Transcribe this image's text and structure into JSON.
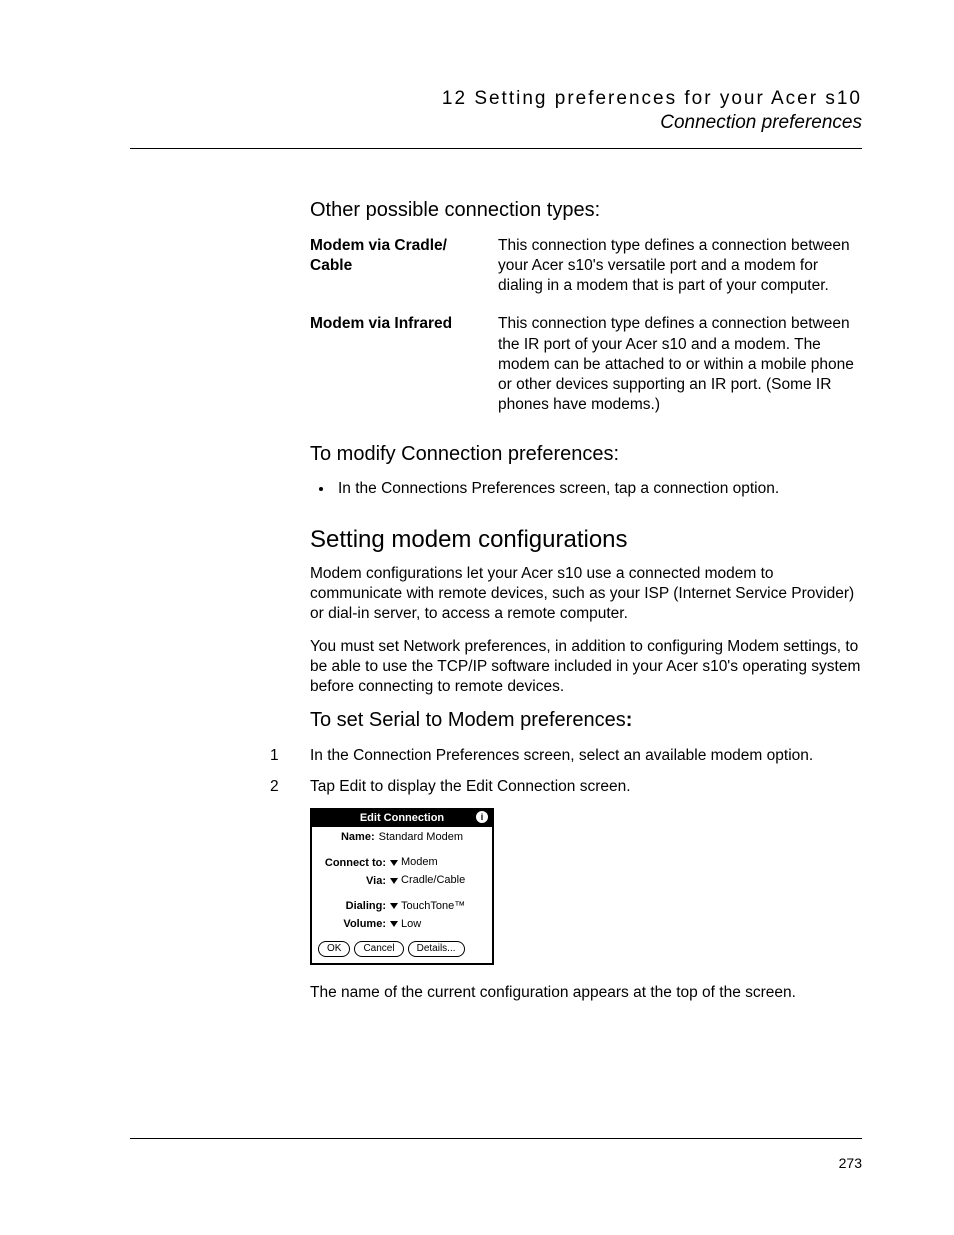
{
  "header": {
    "running_title": "12 Setting preferences for your Acer s10",
    "subtitle": "Connection preferences"
  },
  "sections": {
    "other_types_heading": "Other possible connection types:",
    "defs": [
      {
        "term": "Modem via Cradle/ Cable",
        "desc": "This connection type defines a connection between your Acer s10's versatile port and a modem for dialing in a modem that is part of your computer."
      },
      {
        "term": "Modem via Infrared",
        "desc": "This connection type defines a connection between the IR port of your Acer s10 and a modem. The modem can be attached to or within a mobile phone or other devices supporting an IR port. (Some IR phones have modems.)"
      }
    ],
    "modify_heading": "To modify Connection preferences:",
    "modify_bullet": "In the Connections Preferences screen, tap a connection option.",
    "h2": "Setting modem configurations",
    "para1": "Modem configurations let your Acer s10 use a connected modem to communicate with remote devices, such as your ISP (Internet Service Provider) or dial-in server, to access a remote computer.",
    "para2": "You must set Network preferences, in addition to configuring Modem settings, to be able to use the TCP/IP software included in your Acer s10's operating system before connecting to remote devices.",
    "serial_heading_prefix": "To set Serial to Modem preferences",
    "serial_heading_suffix": ":",
    "steps": [
      "In the Connection Preferences screen, select an available modem option.",
      "Tap Edit to display the Edit Connection screen."
    ],
    "after_fig": "The name of the current configuration appears at the top of the screen."
  },
  "palm": {
    "title": "Edit Connection",
    "fields": {
      "name_label": "Name:",
      "name_value": "Standard Modem",
      "connect_label": "Connect to:",
      "connect_value": "Modem",
      "via_label": "Via:",
      "via_value": "Cradle/Cable",
      "dialing_label": "Dialing:",
      "dialing_value": "TouchTone™",
      "volume_label": "Volume:",
      "volume_value": "Low"
    },
    "buttons": {
      "ok": "OK",
      "cancel": "Cancel",
      "details": "Details..."
    }
  },
  "page_number": "273"
}
